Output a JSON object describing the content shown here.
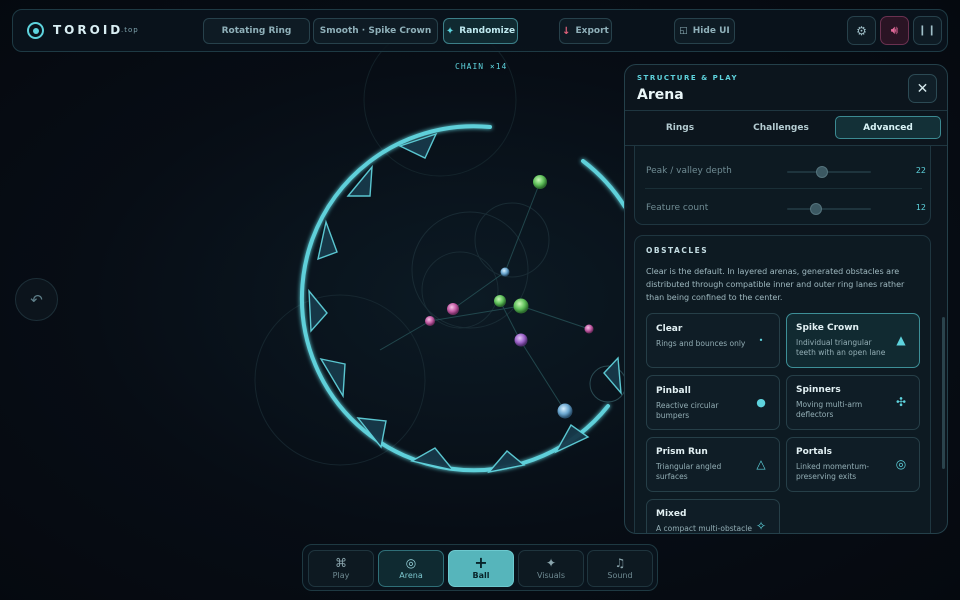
{
  "brand": {
    "name": "TOROID",
    "tld": ".top"
  },
  "toolbar": {
    "preset_1": "Rotating Ring",
    "preset_2": "Smooth · Spike Crown",
    "randomize": "Randomize",
    "export": "Export",
    "hide_ui": "Hide UI"
  },
  "icons": {
    "randomize": "sparkle-icon",
    "export": "download-icon",
    "hide_ui": "hide-icon",
    "settings": "gear-icon",
    "sound": "speaker-icon",
    "pause": "pause-icon",
    "undo": "undo-icon",
    "close": "close-icon"
  },
  "status": {
    "chain": "CHAIN ×14"
  },
  "panel": {
    "kicker": "STRUCTURE & PLAY",
    "title": "Arena",
    "tabs": [
      {
        "label": "Rings",
        "active": false
      },
      {
        "label": "Challenges",
        "active": false
      },
      {
        "label": "Advanced",
        "active": true
      }
    ],
    "sliders": [
      {
        "label": "Peak / valley depth",
        "value": "22",
        "position": 0.42
      },
      {
        "label": "Feature count",
        "value": "12",
        "position": 0.34
      }
    ],
    "obstacles": {
      "heading": "OBSTACLES",
      "description": "Clear is the default. In layered arenas, generated obstacles are distributed through compatible inner and outer ring lanes rather than being confined to the center.",
      "options": [
        {
          "title": "Clear",
          "desc": "Rings and bounces only",
          "icon": "dot-icon",
          "selected": false
        },
        {
          "title": "Spike Crown",
          "desc": "Individual triangular teeth with an open lane",
          "icon": "triangle-filled-icon",
          "selected": true
        },
        {
          "title": "Pinball",
          "desc": "Reactive circular bumpers",
          "icon": "circle-filled-icon",
          "selected": false
        },
        {
          "title": "Spinners",
          "desc": "Moving multi-arm deflectors",
          "icon": "spinner-icon",
          "selected": false
        },
        {
          "title": "Prism Run",
          "desc": "Triangular angled surfaces",
          "icon": "triangle-outline-icon",
          "selected": false
        },
        {
          "title": "Portals",
          "desc": "Linked momentum-preserving exits",
          "icon": "portal-icon",
          "selected": false
        },
        {
          "title": "Mixed",
          "desc": "A compact multi-obstacle",
          "icon": "sparkle-outline-icon",
          "selected": false
        }
      ]
    }
  },
  "bottom_nav": [
    {
      "label": "Play",
      "icon": "command-icon",
      "state": "normal"
    },
    {
      "label": "Arena",
      "icon": "target-icon",
      "state": "active"
    },
    {
      "label": "Ball",
      "icon": "plus-icon",
      "state": "primary"
    },
    {
      "label": "Visuals",
      "icon": "sparkle-icon",
      "state": "normal"
    },
    {
      "label": "Sound",
      "icon": "music-note-icon",
      "state": "normal"
    }
  ],
  "colors": {
    "accent": "#5ed3dd",
    "background": "#060b12",
    "sound_active": "#e56b9b",
    "primary_button": "#56b5bb"
  }
}
